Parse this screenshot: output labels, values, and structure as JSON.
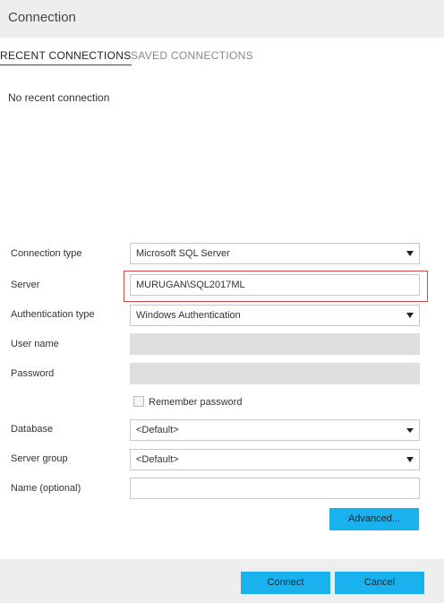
{
  "dialog": {
    "title": "Connection"
  },
  "tabs": [
    {
      "label": "RECENT CONNECTIONS",
      "active": true
    },
    {
      "label": "SAVED CONNECTIONS",
      "active": false
    }
  ],
  "recent": {
    "empty_message": "No recent connection"
  },
  "form": {
    "connection_type": {
      "label": "Connection type",
      "value": "Microsoft SQL Server"
    },
    "server": {
      "label": "Server",
      "value": "MURUGAN\\SQL2017ML"
    },
    "auth_type": {
      "label": "Authentication type",
      "value": "Windows Authentication"
    },
    "user_name": {
      "label": "User name",
      "value": ""
    },
    "password": {
      "label": "Password",
      "value": ""
    },
    "remember_password": {
      "label": "Remember password",
      "checked": false
    },
    "database": {
      "label": "Database",
      "value": "<Default>"
    },
    "server_group": {
      "label": "Server group",
      "value": "<Default>"
    },
    "name": {
      "label": "Name (optional)",
      "value": ""
    },
    "advanced_label": "Advanced..."
  },
  "footer": {
    "connect_label": "Connect",
    "cancel_label": "Cancel"
  },
  "colors": {
    "accent": "#1ab2ee",
    "highlight": "#d44a4a",
    "header_bg": "#eeeeee"
  }
}
